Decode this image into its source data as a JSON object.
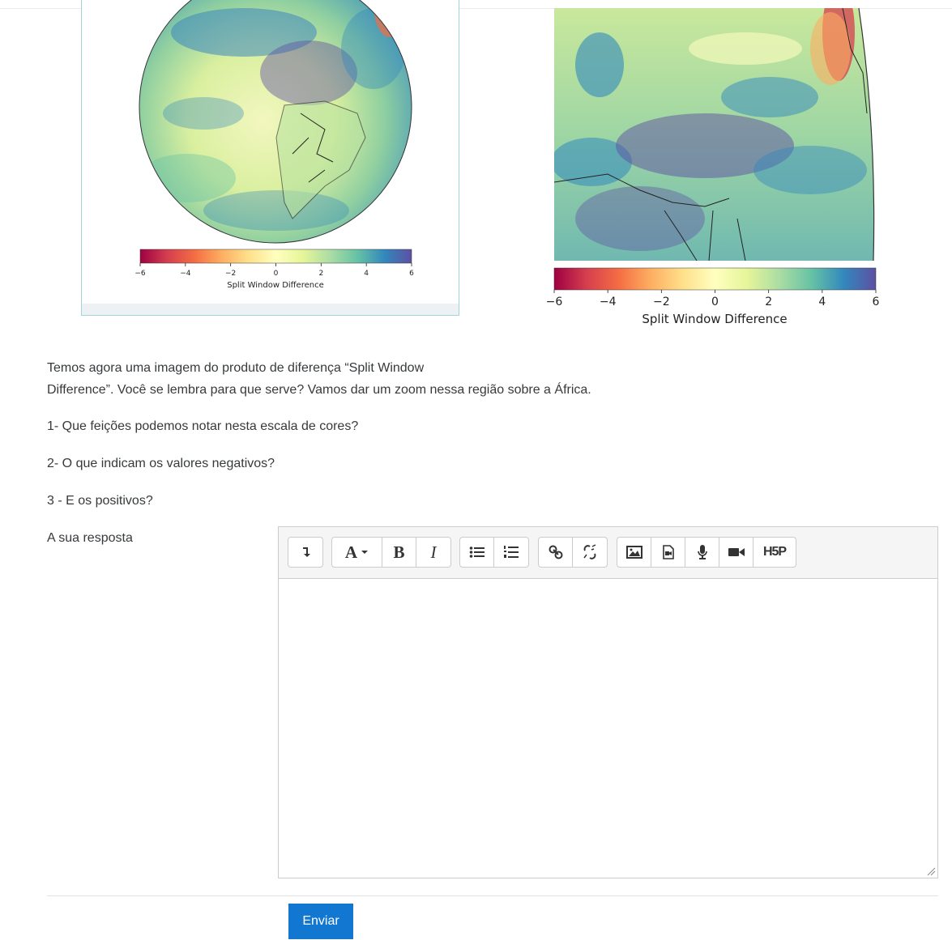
{
  "figures": {
    "left": {
      "colorbar_label": "Split Window Difference",
      "ticks": [
        "−6",
        "−4",
        "−2",
        "0",
        "2",
        "4",
        "6"
      ]
    },
    "right": {
      "colorbar_label": "Split Window Difference",
      "ticks": [
        "−6",
        "−4",
        "−2",
        "0",
        "2",
        "4",
        "6"
      ]
    },
    "colormap": [
      "#9e0142",
      "#d53e4f",
      "#f46d43",
      "#fdae61",
      "#fee08b",
      "#ffffbf",
      "#e6f598",
      "#abdda4",
      "#66c2a5",
      "#3288bd",
      "#5e4fa2"
    ]
  },
  "question": {
    "intro_line1": "Temos agora uma imagem do produto de diferença “Split Window",
    "intro_line2": "Difference”. Você se lembra para que serve? Vamos dar um zoom nessa região sobre a África.",
    "q1": "1- Que feições podemos notar nesta escala de cores?",
    "q2": "2- O que indicam os valores negativos?",
    "q3": "3 - E os positivos?"
  },
  "answer": {
    "label": "A sua resposta",
    "value": ""
  },
  "toolbar": {
    "font_label": "A",
    "bold_label": "B",
    "italic_label": "I",
    "h5p_label": "H5P"
  },
  "submit_label": "Enviar"
}
